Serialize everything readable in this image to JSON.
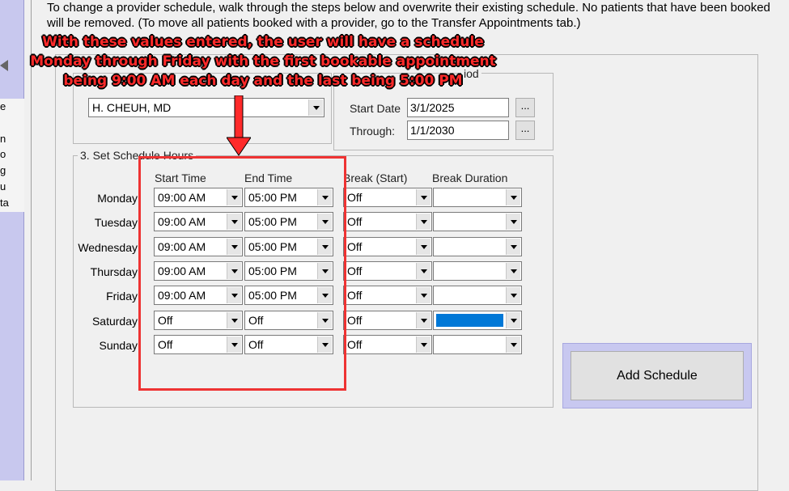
{
  "left_strip": {
    "fragments": [
      "e",
      "",
      "n",
      "o",
      "g",
      "u",
      "ta"
    ]
  },
  "intro_text": "To change a provider schedule, walk through the steps below and overwrite their existing schedule. No patients that have been booked will be removed. (To move all patients booked with a provider, go to the Transfer Appointments tab.)",
  "annotation": {
    "lines": [
      "With these values entered, the user will have a schedule",
      "Monday through Friday with the first bookable appointment",
      "being 9:00 AM each day and the last being 5:00 PM"
    ],
    "color": "#ff2a2a"
  },
  "provider_group": {
    "selected_provider": "H. CHEUH, MD"
  },
  "period_group": {
    "title_fragment": "iod",
    "start_date_label": "Start Date",
    "start_date_value": "3/1/2025",
    "through_label": "Through:",
    "through_value": "1/1/2030",
    "browse_label": "..."
  },
  "hours_group": {
    "title": "3. Set Schedule Hours",
    "columns": {
      "start": "Start Time",
      "end": "End Time",
      "break_start": "Break (Start)",
      "break_duration": "Break Duration"
    },
    "rows": [
      {
        "day": "Monday",
        "start": "09:00 AM",
        "end": "05:00 PM",
        "break_start": "Off",
        "break_duration": ""
      },
      {
        "day": "Tuesday",
        "start": "09:00 AM",
        "end": "05:00 PM",
        "break_start": "Off",
        "break_duration": ""
      },
      {
        "day": "Wednesday",
        "start": "09:00 AM",
        "end": "05:00 PM",
        "break_start": "Off",
        "break_duration": ""
      },
      {
        "day": "Thursday",
        "start": "09:00 AM",
        "end": "05:00 PM",
        "break_start": "Off",
        "break_duration": ""
      },
      {
        "day": "Friday",
        "start": "09:00 AM",
        "end": "05:00 PM",
        "break_start": "Off",
        "break_duration": ""
      },
      {
        "day": "Saturday",
        "start": "Off",
        "end": "Off",
        "break_start": "Off",
        "break_duration": ""
      },
      {
        "day": "Sunday",
        "start": "Off",
        "end": "Off",
        "break_start": "Off",
        "break_duration": ""
      }
    ]
  },
  "add_schedule_label": "Add Schedule",
  "colors": {
    "highlight": "#ee3333",
    "selection": "#0078d7",
    "button_frame": "#c8c8f0"
  }
}
